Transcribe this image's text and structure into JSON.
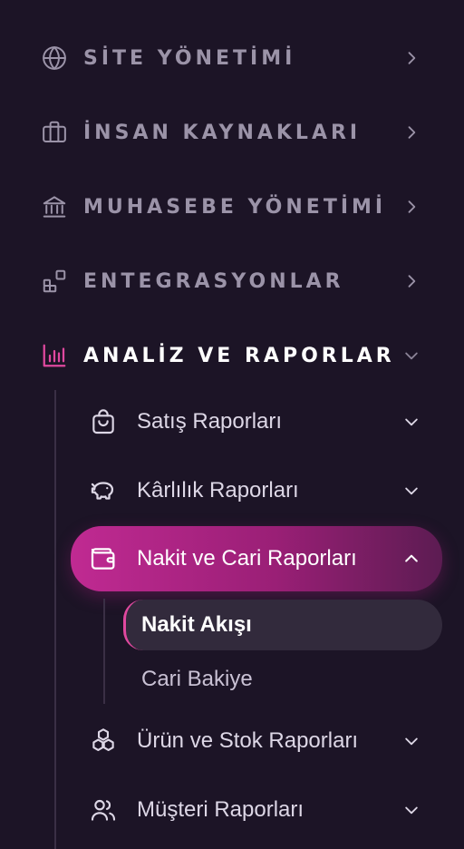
{
  "sections": [
    {
      "label": "SİTE YÖNETİMİ",
      "icon": "globe-icon"
    },
    {
      "label": "İNSAN KAYNAKLARI",
      "icon": "briefcase-icon"
    },
    {
      "label": "MUHASEBE YÖNETİMİ",
      "icon": "bank-icon"
    },
    {
      "label": "ENTEGRASYONLAR",
      "icon": "integrations-icon"
    },
    {
      "label": "ANALİZ VE RAPORLAR",
      "icon": "bar-chart-icon",
      "expanded": true
    }
  ],
  "subsections": [
    {
      "label": "Satış Raporları",
      "icon": "shopping-bag-icon"
    },
    {
      "label": "Kârlılık Raporları",
      "icon": "piggy-bank-icon"
    },
    {
      "label": "Nakit ve Cari Raporları",
      "icon": "wallet-icon",
      "expanded": true
    },
    {
      "label": "Ürün ve Stok Raporları",
      "icon": "boxes-icon"
    },
    {
      "label": "Müşteri Raporları",
      "icon": "users-icon"
    }
  ],
  "leaves": [
    {
      "label": "Nakit Akışı",
      "selected": true
    },
    {
      "label": "Cari Bakiye"
    }
  ],
  "colors": {
    "background": "#1c1426",
    "accent": "#c02a92",
    "accent_icon": "#e0489f",
    "muted_text": "#9b93a8",
    "selected_bg": "#322a3c"
  }
}
